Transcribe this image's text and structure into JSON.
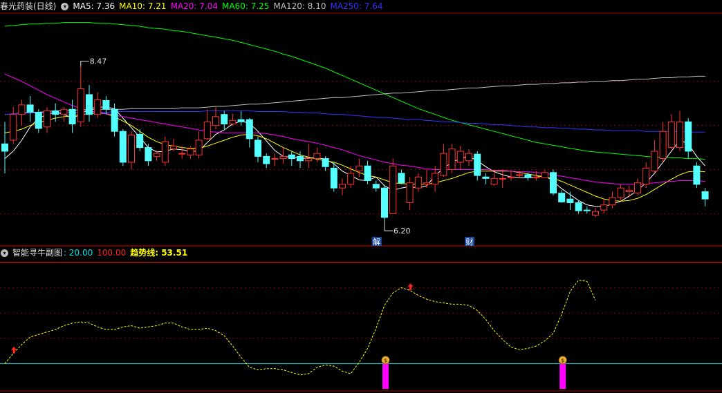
{
  "main_header": {
    "stock": "春光药装(日线)",
    "ma": [
      {
        "label": "MA5: 7.36",
        "color": "#ffffff"
      },
      {
        "label": "MA10: 7.21",
        "color": "#ffff00"
      },
      {
        "label": "MA20: 7.04",
        "color": "#ff00ff"
      },
      {
        "label": "MA60: 7.25",
        "color": "#00ff00"
      },
      {
        "label": "MA120: 8.10",
        "color": "#c0c0c0"
      },
      {
        "label": "MA250: 7.64",
        "color": "#3333ff"
      }
    ]
  },
  "sub_header": {
    "name": "智能寻牛副图",
    "values": [
      {
        "label": ": 20.00",
        "color": "#00e5e5"
      },
      {
        "label": "100.00",
        "color": "#ff2222"
      },
      {
        "label": "趋势线: 53.51",
        "color": "#ffff00"
      }
    ]
  },
  "annotations": {
    "high": "8.47",
    "low": "6.20",
    "markers": [
      "解",
      "财"
    ]
  },
  "colors": {
    "up": "#ff3333",
    "down": "#54ffff",
    "grid": "#8b0000",
    "divider": "#b00000"
  },
  "chart_data": [
    {
      "type": "candlestick",
      "ylim": [
        5.8,
        8.9
      ],
      "candles": [
        [
          7.15,
          7.05,
          7.45,
          6.75
        ],
        [
          7.2,
          7.55,
          7.65,
          7.15
        ],
        [
          7.55,
          7.68,
          7.75,
          7.4
        ],
        [
          7.68,
          7.58,
          7.8,
          7.45
        ],
        [
          7.58,
          7.36,
          7.62,
          7.3
        ],
        [
          7.38,
          7.6,
          7.65,
          7.3
        ],
        [
          7.6,
          7.55,
          7.7,
          7.45
        ],
        [
          7.55,
          7.62,
          7.65,
          7.45
        ],
        [
          7.62,
          7.42,
          7.75,
          7.3
        ],
        [
          7.45,
          7.9,
          8.2,
          7.38
        ],
        [
          7.82,
          7.55,
          7.95,
          7.45
        ],
        [
          7.55,
          7.75,
          7.85,
          7.5
        ],
        [
          7.74,
          7.62,
          7.8,
          7.55
        ],
        [
          7.62,
          7.32,
          7.7,
          7.25
        ],
        [
          7.32,
          6.9,
          7.35,
          6.85
        ],
        [
          6.9,
          7.27,
          7.32,
          6.8
        ],
        [
          7.28,
          7.1,
          7.35,
          7.05
        ],
        [
          7.1,
          6.92,
          7.15,
          6.85
        ],
        [
          6.98,
          7.02,
          7.06,
          6.92
        ],
        [
          6.9,
          7.18,
          7.25,
          6.85
        ],
        [
          7.08,
          7.12,
          7.22,
          7.05
        ],
        [
          7.02,
          7.02,
          7.12,
          6.95
        ],
        [
          7.0,
          7.08,
          7.12,
          6.95
        ],
        [
          7.0,
          7.2,
          7.32,
          6.95
        ],
        [
          7.22,
          7.45,
          7.62,
          7.2
        ],
        [
          7.4,
          7.52,
          7.65,
          7.35
        ],
        [
          7.55,
          7.42,
          7.6,
          7.35
        ],
        [
          7.42,
          7.47,
          7.56,
          7.4
        ],
        [
          7.48,
          7.45,
          7.6,
          7.4
        ],
        [
          7.48,
          7.22,
          7.5,
          7.1
        ],
        [
          7.2,
          6.98,
          7.25,
          6.9
        ],
        [
          6.98,
          6.88,
          7.02,
          6.82
        ],
        [
          6.95,
          6.95,
          7.02,
          6.85
        ],
        [
          6.95,
          6.98,
          7.1,
          6.88
        ],
        [
          7.0,
          6.95,
          7.05,
          6.85
        ],
        [
          6.98,
          6.92,
          7.05,
          6.82
        ],
        [
          6.92,
          6.95,
          7.15,
          6.82
        ],
        [
          6.95,
          7.02,
          7.1,
          6.9
        ],
        [
          6.95,
          6.84,
          6.98,
          6.78
        ],
        [
          6.82,
          6.55,
          6.9,
          6.5
        ],
        [
          6.55,
          6.6,
          6.68,
          6.45
        ],
        [
          6.6,
          6.75,
          6.85,
          6.55
        ],
        [
          6.78,
          6.85,
          6.95,
          6.7
        ],
        [
          6.85,
          6.65,
          6.92,
          6.6
        ],
        [
          6.6,
          6.55,
          6.65,
          6.5
        ],
        [
          6.55,
          6.15,
          6.58,
          6.1
        ],
        [
          6.2,
          6.85,
          6.95,
          6.2
        ],
        [
          6.75,
          6.62,
          6.8,
          6.6
        ],
        [
          6.35,
          6.62,
          6.7,
          6.25
        ],
        [
          6.55,
          6.7,
          6.75,
          6.5
        ],
        [
          6.6,
          6.62,
          6.8,
          6.55
        ],
        [
          6.6,
          6.75,
          6.85,
          6.5
        ],
        [
          6.72,
          7.02,
          7.15,
          6.7
        ],
        [
          6.8,
          7.08,
          7.15,
          6.75
        ],
        [
          6.9,
          7.05,
          7.12,
          6.8
        ],
        [
          6.92,
          7.02,
          7.08,
          6.85
        ],
        [
          7.01,
          6.72,
          7.05,
          6.65
        ],
        [
          6.7,
          6.68,
          6.75,
          6.6
        ],
        [
          6.6,
          6.68,
          6.75,
          6.58
        ],
        [
          6.68,
          6.68,
          6.8,
          6.55
        ],
        [
          6.7,
          6.7,
          6.78,
          6.65
        ],
        [
          6.72,
          6.73,
          6.78,
          6.68
        ],
        [
          6.73,
          6.69,
          6.76,
          6.65
        ],
        [
          6.69,
          6.7,
          6.78,
          6.65
        ],
        [
          6.69,
          6.76,
          6.8,
          6.68
        ],
        [
          6.76,
          6.48,
          6.8,
          6.45
        ],
        [
          6.48,
          6.36,
          6.52,
          6.35
        ],
        [
          6.4,
          6.35,
          6.5,
          6.25
        ],
        [
          6.35,
          6.24,
          6.38,
          6.2
        ],
        [
          6.25,
          6.24,
          6.3,
          6.2
        ],
        [
          6.18,
          6.23,
          6.28,
          6.15
        ],
        [
          6.25,
          6.32,
          6.4,
          6.2
        ],
        [
          6.32,
          6.42,
          6.5,
          6.28
        ],
        [
          6.42,
          6.55,
          6.6,
          6.38
        ],
        [
          6.5,
          6.52,
          6.58,
          6.42
        ],
        [
          6.48,
          6.62,
          6.68,
          6.45
        ],
        [
          6.6,
          6.82,
          6.9,
          6.55
        ],
        [
          6.78,
          7.05,
          7.2,
          6.75
        ],
        [
          6.95,
          7.32,
          7.45,
          6.9
        ],
        [
          7.1,
          7.45,
          7.55,
          7.08
        ],
        [
          7.1,
          7.45,
          7.6,
          7.05
        ],
        [
          7.45,
          7.05,
          7.5,
          6.95
        ],
        [
          6.85,
          6.6,
          6.9,
          6.55
        ],
        [
          6.5,
          6.4,
          6.55,
          6.3
        ]
      ],
      "ma_lines": [
        {
          "name": "MA5",
          "color": "#ffffff",
          "values": [
            6.95,
            7.05,
            7.2,
            7.38,
            7.5,
            7.55,
            7.58,
            7.55,
            7.5,
            7.55,
            7.63,
            7.65,
            7.65,
            7.63,
            7.5,
            7.37,
            7.24,
            7.1,
            7.04,
            7.05,
            7.08,
            7.07,
            7.05,
            7.05,
            7.17,
            7.28,
            7.34,
            7.42,
            7.46,
            7.43,
            7.32,
            7.19,
            7.06,
            6.98,
            6.97,
            6.95,
            6.96,
            6.96,
            6.94,
            6.88,
            6.78,
            6.72,
            6.66,
            6.65,
            6.7,
            6.58,
            6.52,
            6.55,
            6.57,
            6.55,
            6.58,
            6.72,
            6.82,
            6.9,
            6.95,
            6.98,
            6.92,
            6.84,
            6.77,
            6.73,
            6.7,
            6.69,
            6.69,
            6.7,
            6.72,
            6.64,
            6.54,
            6.46,
            6.38,
            6.32,
            6.3,
            6.3,
            6.33,
            6.37,
            6.44,
            6.52,
            6.62,
            6.75,
            6.9,
            7.05,
            7.2,
            7.15,
            6.98,
            6.85
          ]
        },
        {
          "name": "MA10",
          "color": "#ffff00",
          "values": [
            7.3,
            7.32,
            7.35,
            7.4,
            7.44,
            7.47,
            7.5,
            7.52,
            7.53,
            7.55,
            7.56,
            7.57,
            7.56,
            7.52,
            7.46,
            7.4,
            7.32,
            7.24,
            7.18,
            7.14,
            7.12,
            7.1,
            7.09,
            7.09,
            7.12,
            7.16,
            7.2,
            7.24,
            7.27,
            7.28,
            7.26,
            7.22,
            7.16,
            7.1,
            7.05,
            7.0,
            6.97,
            6.94,
            6.92,
            6.9,
            6.86,
            6.81,
            6.76,
            6.72,
            6.7,
            6.66,
            6.62,
            6.61,
            6.6,
            6.6,
            6.6,
            6.62,
            6.65,
            6.68,
            6.72,
            6.76,
            6.78,
            6.78,
            6.78,
            6.78,
            6.78,
            6.76,
            6.74,
            6.72,
            6.7,
            6.68,
            6.64,
            6.59,
            6.54,
            6.49,
            6.44,
            6.4,
            6.38,
            6.37,
            6.38,
            6.41,
            6.46,
            6.53,
            6.6,
            6.67,
            6.73,
            6.77,
            6.78,
            6.77
          ]
        },
        {
          "name": "MA20",
          "color": "#ff00ff",
          "values": [
            8.1,
            8.05,
            8.0,
            7.94,
            7.88,
            7.82,
            7.77,
            7.72,
            7.67,
            7.63,
            7.6,
            7.58,
            7.56,
            7.54,
            7.52,
            7.5,
            7.48,
            7.46,
            7.44,
            7.42,
            7.4,
            7.38,
            7.36,
            7.34,
            7.32,
            7.31,
            7.3,
            7.3,
            7.3,
            7.3,
            7.3,
            7.29,
            7.27,
            7.25,
            7.22,
            7.2,
            7.18,
            7.16,
            7.13,
            7.1,
            7.07,
            7.03,
            6.99,
            6.96,
            6.93,
            6.9,
            6.88,
            6.86,
            6.85,
            6.83,
            6.81,
            6.8,
            6.8,
            6.8,
            6.8,
            6.8,
            6.8,
            6.8,
            6.79,
            6.79,
            6.78,
            6.77,
            6.77,
            6.76,
            6.75,
            6.73,
            6.71,
            6.69,
            6.67,
            6.65,
            6.63,
            6.62,
            6.61,
            6.6,
            6.6,
            6.6,
            6.61,
            6.62,
            6.63,
            6.64,
            6.65,
            6.65,
            6.65,
            6.64
          ]
        },
        {
          "name": "MA60",
          "color": "#00ff00",
          "values": [
            8.75,
            8.76,
            8.77,
            8.78,
            8.78,
            8.79,
            8.79,
            8.8,
            8.8,
            8.8,
            8.8,
            8.79,
            8.79,
            8.78,
            8.77,
            8.76,
            8.75,
            8.73,
            8.72,
            8.71,
            8.69,
            8.68,
            8.66,
            8.64,
            8.62,
            8.6,
            8.58,
            8.56,
            8.53,
            8.5,
            8.47,
            8.44,
            8.41,
            8.37,
            8.34,
            8.3,
            8.26,
            8.22,
            8.18,
            8.13,
            8.08,
            8.03,
            7.98,
            7.93,
            7.88,
            7.83,
            7.78,
            7.73,
            7.68,
            7.63,
            7.59,
            7.55,
            7.51,
            7.47,
            7.44,
            7.41,
            7.38,
            7.35,
            7.32,
            7.29,
            7.26,
            7.23,
            7.2,
            7.17,
            7.15,
            7.13,
            7.11,
            7.09,
            7.07,
            7.05,
            7.04,
            7.03,
            7.02,
            7.01,
            7.0,
            6.99,
            6.98,
            6.97,
            6.97,
            6.96,
            6.96,
            6.95,
            6.95,
            6.94
          ]
        },
        {
          "name": "MA120",
          "color": "#c0c0c0",
          "values": [
            7.55,
            7.56,
            7.57,
            7.58,
            7.58,
            7.59,
            7.6,
            7.6,
            7.61,
            7.61,
            7.62,
            7.62,
            7.62,
            7.62,
            7.62,
            7.63,
            7.63,
            7.63,
            7.63,
            7.63,
            7.63,
            7.64,
            7.64,
            7.64,
            7.65,
            7.66,
            7.66,
            7.67,
            7.68,
            7.69,
            7.69,
            7.7,
            7.71,
            7.72,
            7.73,
            7.74,
            7.75,
            7.76,
            7.77,
            7.78,
            7.78,
            7.79,
            7.8,
            7.81,
            7.82,
            7.83,
            7.84,
            7.84,
            7.85,
            7.86,
            7.87,
            7.88,
            7.88,
            7.89,
            7.9,
            7.91,
            7.91,
            7.92,
            7.93,
            7.94,
            7.94,
            7.95,
            7.96,
            7.96,
            7.97,
            7.97,
            7.98,
            7.98,
            7.99,
            7.99,
            8.0,
            8.0,
            8.01,
            8.01,
            8.02,
            8.03,
            8.03,
            8.04,
            8.05,
            8.05,
            8.06,
            8.06,
            8.07,
            8.07
          ]
        },
        {
          "name": "MA250",
          "color": "#3333ff",
          "values": [
            7.55,
            7.56,
            7.56,
            7.57,
            7.57,
            7.57,
            7.58,
            7.58,
            7.58,
            7.58,
            7.58,
            7.58,
            7.58,
            7.59,
            7.59,
            7.59,
            7.59,
            7.59,
            7.59,
            7.59,
            7.59,
            7.59,
            7.59,
            7.59,
            7.6,
            7.6,
            7.6,
            7.6,
            7.6,
            7.6,
            7.59,
            7.59,
            7.59,
            7.59,
            7.58,
            7.58,
            7.57,
            7.57,
            7.56,
            7.55,
            7.55,
            7.54,
            7.53,
            7.52,
            7.51,
            7.51,
            7.5,
            7.49,
            7.48,
            7.48,
            7.47,
            7.46,
            7.45,
            7.45,
            7.44,
            7.43,
            7.43,
            7.42,
            7.41,
            7.41,
            7.4,
            7.39,
            7.38,
            7.38,
            7.37,
            7.37,
            7.36,
            7.36,
            7.35,
            7.35,
            7.34,
            7.34,
            7.33,
            7.33,
            7.33,
            7.33,
            7.32,
            7.32,
            7.32,
            7.32,
            7.32,
            7.31,
            7.31,
            7.31
          ]
        }
      ]
    },
    {
      "type": "line",
      "ylim": [
        0,
        100
      ],
      "reference_lines": [
        {
          "value": 20,
          "color": "#00e5e5"
        },
        {
          "value": 100,
          "color": "#ff2222"
        }
      ],
      "trend": {
        "name": "趋势线",
        "color": "#ffff00",
        "values": [
          20,
          28,
          35,
          41,
          43,
          45,
          47,
          50,
          52,
          53,
          52,
          49,
          47,
          47,
          49,
          50,
          48,
          49,
          50,
          52,
          52,
          49,
          47,
          47,
          48,
          46,
          42,
          34,
          25,
          17,
          15,
          16,
          16,
          15,
          13,
          11,
          12,
          17,
          19,
          18,
          14,
          12,
          21,
          32,
          48,
          66,
          76,
          80,
          78,
          74,
          71,
          69,
          68,
          67,
          67,
          66,
          62,
          55,
          46,
          39,
          33,
          31,
          32,
          34,
          38,
          44,
          59,
          77,
          86,
          85,
          70
        ]
      },
      "signals": [
        {
          "index": 45,
          "low": 0,
          "high": 20
        },
        {
          "index": 66,
          "low": 0,
          "high": 20
        }
      ],
      "arrows": [
        1,
        48
      ]
    }
  ]
}
